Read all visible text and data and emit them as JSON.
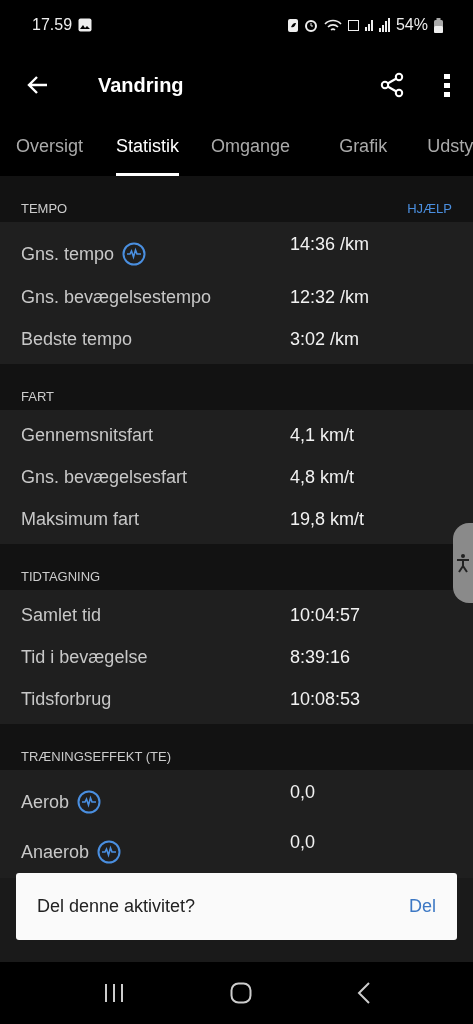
{
  "status_bar": {
    "time": "17.59",
    "battery": "54%"
  },
  "app_bar": {
    "title": "Vandring"
  },
  "tabs": [
    {
      "label": "Oversigt",
      "selected": false
    },
    {
      "label": "Statistik",
      "selected": true
    },
    {
      "label": "Omgange",
      "selected": false
    },
    {
      "label": "Grafik",
      "selected": false
    },
    {
      "label": "Udsty",
      "selected": false
    }
  ],
  "sections": [
    {
      "title": "TEMPO",
      "action": "HJÆLP",
      "rows": [
        {
          "label": "Gns. tempo",
          "value": "14:36 /km",
          "info": true
        },
        {
          "label": "Gns. bevægelsestempo",
          "value": "12:32 /km",
          "info": false
        },
        {
          "label": "Bedste tempo",
          "value": "3:02 /km",
          "info": false
        }
      ]
    },
    {
      "title": "FART",
      "rows": [
        {
          "label": "Gennemsnitsfart",
          "value": "4,1 km/t",
          "info": false
        },
        {
          "label": "Gns. bevægelsesfart",
          "value": "4,8 km/t",
          "info": false
        },
        {
          "label": "Maksimum fart",
          "value": "19,8 km/t",
          "info": false
        }
      ]
    },
    {
      "title": "TIDTAGNING",
      "rows": [
        {
          "label": "Samlet tid",
          "value": "10:04:57",
          "info": false
        },
        {
          "label": "Tid i bevægelse",
          "value": "8:39:16",
          "info": false
        },
        {
          "label": "Tidsforbrug",
          "value": "10:08:53",
          "info": false
        }
      ]
    },
    {
      "title": "TRÆNINGSEFFEKT (TE)",
      "rows": [
        {
          "label": "Aerob",
          "value": "0,0",
          "info": true
        },
        {
          "label": "Anaerob",
          "value": "0,0",
          "info": true
        }
      ]
    }
  ],
  "snackbar": {
    "text": "Del denne aktivitet?",
    "action": "Del"
  }
}
